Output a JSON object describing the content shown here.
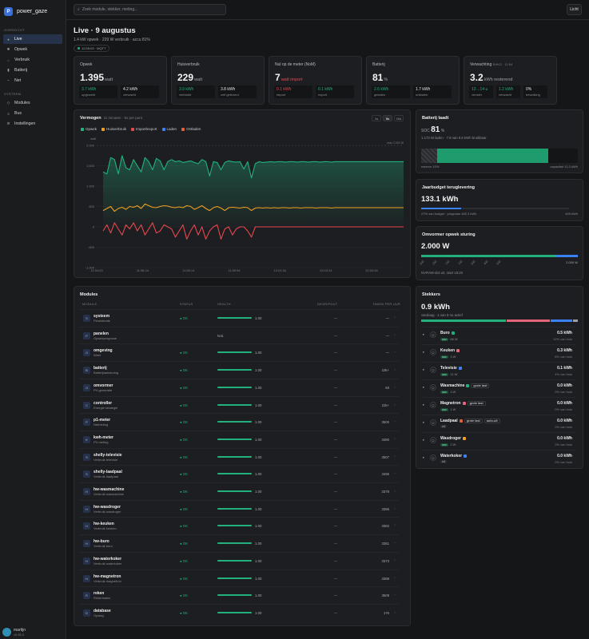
{
  "app": {
    "name": "power_gaze",
    "logo_letter": "P"
  },
  "sidebar": {
    "section_overview": "OVERZICHT",
    "section_system": "SYSTEEM",
    "items": [
      {
        "label": "Live",
        "icon": "dot-icon"
      },
      {
        "label": "Opwek",
        "icon": "sun-icon"
      },
      {
        "label": "Verbruik",
        "icon": "home-icon"
      },
      {
        "label": "Batterij",
        "icon": "battery-icon"
      },
      {
        "label": "Net",
        "icon": "grid-icon"
      },
      {
        "label": "Modules",
        "icon": "modules-icon"
      },
      {
        "label": "Bus",
        "icon": "bus-icon"
      },
      {
        "label": "Instellingen",
        "icon": "gear-icon"
      }
    ],
    "user": {
      "name": "martijn",
      "version": "v0.85.0"
    }
  },
  "topbar": {
    "search_placeholder": "Zoek module, stekker, meting...",
    "theme_label": "Licht"
  },
  "header": {
    "title": "Live · 9 augustus",
    "subtitle": "1.4 kW opwek · 229 W verbruik · accu 81%",
    "status": "12:05:03 · MQTT"
  },
  "kpis": [
    {
      "label": "Opwek",
      "value": "1.395",
      "unit": "watt",
      "boxes": [
        {
          "v": "3.7 kWh",
          "l": "opgewekt",
          "c": "g"
        },
        {
          "v": "4.2 kWh",
          "l": "verwacht",
          "c": ""
        }
      ]
    },
    {
      "label": "Huisverbruik",
      "value": "229",
      "unit": "watt",
      "boxes": [
        {
          "v": "3.9 kWh",
          "l": "verbruikt",
          "c": "g"
        },
        {
          "v": "3.8 kWh",
          "l": "zelf geleverd",
          "c": ""
        }
      ]
    },
    {
      "label": "Nul op de meter (NoM)",
      "value": "7",
      "unit": "watt import",
      "boxes": [
        {
          "v": "0.1 kWh",
          "l": "import",
          "c": "r"
        },
        {
          "v": "0.1 kWh",
          "l": "export",
          "c": "g"
        }
      ]
    },
    {
      "label": "Batterij",
      "value": "81",
      "unit": "%",
      "boxes": [
        {
          "v": "2.6 kWh",
          "l": "geladen",
          "c": "g"
        },
        {
          "v": "1.7 kWh",
          "l": "ontladen",
          "c": ""
        }
      ]
    },
    {
      "label": "Verwachting",
      "label_extra": "EHKG · 11:54",
      "value": "3.2",
      "unit": "kWh resterend",
      "boxes": [
        {
          "v": "12→14 u",
          "l": "venster",
          "c": "g"
        },
        {
          "v": "1.2 kWh",
          "l": "verwacht",
          "c": "g"
        },
        {
          "v": "0%",
          "l": "bewolking",
          "c": ""
        }
      ]
    }
  ],
  "vermogen": {
    "title": "Vermogen",
    "subtitle": "11 minuten · 5s per punt",
    "ranges": [
      "1s",
      "5s",
      "10s"
    ],
    "active_range": "5s",
    "legend": [
      {
        "name": "Opwek",
        "color": "#22b07d"
      },
      {
        "name": "Huisverbruik",
        "color": "#f0a020"
      },
      {
        "name": "Import/export",
        "color": "#e5484d"
      },
      {
        "name": "Laden",
        "color": "#3b82f6"
      },
      {
        "name": "Ontladen",
        "color": "#e0623a"
      }
    ],
    "max_label": "max 2.000 W"
  },
  "chart_data": {
    "type": "line",
    "ylabel": "watt",
    "ylim": [
      -1000,
      2000
    ],
    "yticks": [
      "2.000",
      "1.500",
      "1.000",
      "500",
      "0",
      "-500",
      "-1.000"
    ],
    "xticks": [
      "11:54:03",
      "11:56:24",
      "11:58:14",
      "11:59:54",
      "12:01:34",
      "12:03:14",
      "12:04:54"
    ],
    "series": [
      {
        "name": "Opwek",
        "color": "#22b07d",
        "values": [
          1350,
          1300,
          1700,
          1650,
          1300,
          1750,
          1450,
          1400,
          1650,
          1500,
          1350,
          1700,
          1600,
          1400,
          1680,
          1620,
          1400,
          1600,
          1650,
          1600,
          1620,
          1580,
          1600,
          1620,
          1580,
          1550,
          1650,
          1600,
          1250,
          1600,
          1580,
          1400,
          1580,
          1620,
          1600,
          1590,
          1600,
          1420,
          1600,
          1200,
          1550,
          1600,
          1580,
          1590,
          1600,
          1590,
          1600,
          1600,
          1590,
          1600,
          1600,
          1590,
          1600,
          1600,
          1590,
          1600,
          1600,
          1590,
          1600,
          1600,
          1590,
          1600,
          1600,
          1600,
          1600,
          1600,
          1600,
          1600,
          1600,
          1600,
          1600,
          1600,
          1600,
          1600,
          1600,
          1600,
          1600,
          1600,
          1600,
          1600
        ]
      },
      {
        "name": "Huisverbruik",
        "color": "#f0a020",
        "values": [
          400,
          450,
          500,
          380,
          450,
          480,
          430,
          500,
          480,
          520,
          450,
          560,
          520,
          480,
          470,
          500,
          520,
          510,
          480,
          470,
          490,
          470,
          520,
          500,
          430,
          470,
          520,
          450,
          400,
          470,
          500,
          460,
          400,
          470,
          480,
          470,
          460,
          480,
          470,
          400,
          460,
          470,
          460,
          470,
          460,
          470,
          460,
          470,
          470,
          460,
          470,
          470,
          460,
          470,
          470,
          470,
          460,
          470,
          470,
          470,
          460,
          470,
          470,
          470,
          470,
          470,
          470,
          470,
          470,
          470,
          470,
          470,
          470,
          470,
          470,
          470,
          470,
          470,
          470,
          470
        ]
      },
      {
        "name": "Import/export",
        "color": "#e5484d",
        "values": [
          -100,
          50,
          -150,
          100,
          -50,
          -200,
          50,
          -50,
          100,
          -100,
          50,
          -200,
          -50,
          100,
          -150,
          -100,
          50,
          0,
          -50,
          -250,
          -100,
          50,
          -300,
          -100,
          50,
          -200,
          0,
          -300,
          -100,
          0,
          50,
          -300,
          -50,
          0,
          -200,
          -50,
          0,
          0,
          -100,
          -250,
          0,
          0,
          0,
          0,
          0,
          0,
          0,
          0,
          0,
          0,
          0,
          0,
          0,
          0,
          0,
          0,
          0,
          0,
          0,
          0,
          0,
          0,
          0,
          0,
          0,
          0,
          0,
          0,
          0,
          0,
          0,
          0,
          0,
          0,
          0,
          0,
          0,
          0,
          0,
          0
        ]
      }
    ]
  },
  "battery": {
    "title": "Batterij laadt",
    "soc_label": "SOC",
    "soc": "81",
    "soc_unit": "%",
    "detail": "1.173 W laden · 7.8 van 9.6 kWh bruikbaar",
    "soc_fraction": 0.81,
    "reserve_fraction": 0.1,
    "reserve_label": "reserve 10%",
    "capacity_label": "capaciteit 11.0 kWh"
  },
  "budget": {
    "title": "Jaarbudget teruglevering",
    "value": "133.1 kWh",
    "fraction": 0.27,
    "left": "27% van budget · prognose 482.3 kWh",
    "right": "499 kWh"
  },
  "omvormer": {
    "title": "Omvormer opwek sturing",
    "value": "2.000 W",
    "fraction": 0.86,
    "ticks": [
      "300",
      "250",
      "150",
      "100",
      "300",
      "400",
      "500"
    ],
    "right": "2.000 W",
    "footer": "NVRAM-slot uit, start 18:20"
  },
  "modules": {
    "title": "Modules",
    "headers": [
      "MODULE",
      "STATUS",
      "HEALTH",
      "DEGR/FOUT",
      "TAKEN PER UUR"
    ],
    "rows": [
      {
        "letter": "S",
        "name": "systeem",
        "desc": "Persistentie",
        "status": "● OK",
        "health": 1.0,
        "hlabel": "1.00",
        "err": "—",
        "tasks": "—"
      },
      {
        "letter": "P",
        "name": "panelen",
        "desc": "Opwekprognose",
        "status": "",
        "health": 0,
        "hlabel": "N.B.",
        "err": "—",
        "tasks": "—"
      },
      {
        "letter": "O",
        "name": "omgeving",
        "desc": "Weer",
        "status": "● OK",
        "health": 1.0,
        "hlabel": "1.00",
        "err": "—",
        "tasks": "—"
      },
      {
        "letter": "B",
        "name": "batterij",
        "desc": "Batterijaansturing",
        "status": "● OK",
        "health": 1.0,
        "hlabel": "1.00",
        "err": "—",
        "tasks": "10k+"
      },
      {
        "letter": "O",
        "name": "omvormer",
        "desc": "PV-generatie",
        "status": "● OK",
        "health": 1.0,
        "hlabel": "1.00",
        "err": "—",
        "tasks": "60"
      },
      {
        "letter": "C",
        "name": "controller",
        "desc": "Energie strategie",
        "status": "● OK",
        "health": 1.0,
        "hlabel": "1.00",
        "err": "—",
        "tasks": "22k+"
      },
      {
        "letter": "P",
        "name": "p1-meter",
        "desc": "Netmeting",
        "status": "● OK",
        "health": 1.0,
        "hlabel": "1.00",
        "err": "—",
        "tasks": "3500"
      },
      {
        "letter": "K",
        "name": "kwh-meter",
        "desc": "PV-meting",
        "status": "● OK",
        "health": 1.0,
        "hlabel": "1.00",
        "err": "—",
        "tasks": "3480"
      },
      {
        "letter": "S",
        "name": "shelly-televisie",
        "desc": "Verbruik televisie",
        "status": "● OK",
        "health": 1.0,
        "hlabel": "1.00",
        "err": "—",
        "tasks": "3507"
      },
      {
        "letter": "S",
        "name": "shelly-laadpaal",
        "desc": "Verbruik laadpaal",
        "status": "● OK",
        "health": 1.0,
        "hlabel": "1.00",
        "err": "—",
        "tasks": "3495"
      },
      {
        "letter": "H",
        "name": "hw-wasmachine",
        "desc": "Verbruik wasmachine",
        "status": "● OK",
        "health": 1.0,
        "hlabel": "1.00",
        "err": "—",
        "tasks": "3378"
      },
      {
        "letter": "H",
        "name": "hw-wasdroger",
        "desc": "Verbruik wasdroger",
        "status": "● OK",
        "health": 1.0,
        "hlabel": "1.00",
        "err": "—",
        "tasks": "3396"
      },
      {
        "letter": "H",
        "name": "hw-keuken",
        "desc": "Verbruik keuken",
        "status": "● OK",
        "health": 1.0,
        "hlabel": "1.00",
        "err": "—",
        "tasks": "3382"
      },
      {
        "letter": "H",
        "name": "hw-buro",
        "desc": "Verbruik buro",
        "status": "● OK",
        "health": 1.0,
        "hlabel": "1.00",
        "err": "—",
        "tasks": "3381"
      },
      {
        "letter": "H",
        "name": "hw-waterkoker",
        "desc": "Verbruik waterkoker",
        "status": "● OK",
        "health": 1.0,
        "hlabel": "1.00",
        "err": "—",
        "tasks": "3373"
      },
      {
        "letter": "H",
        "name": "hw-magnetron",
        "desc": "Verbruik magnetron",
        "status": "● OK",
        "health": 1.0,
        "hlabel": "1.00",
        "err": "—",
        "tasks": "3388"
      },
      {
        "letter": "R",
        "name": "reken",
        "desc": "Rekenhalen",
        "status": "● OK",
        "health": 1.0,
        "hlabel": "1.00",
        "err": "—",
        "tasks": "3508"
      },
      {
        "letter": "D",
        "name": "database",
        "desc": "Opslag",
        "status": "● OK",
        "health": 1.0,
        "hlabel": "1.00",
        "err": "—",
        "tasks": "176"
      }
    ]
  },
  "stekkers": {
    "title": "Stekkers",
    "total": "0.9 kWh",
    "total_sub": "vandaag · 4 van 8 nu actief",
    "bar": [
      {
        "color": "#22b07d",
        "frac": 0.55
      },
      {
        "color": "#e5647a",
        "frac": 0.28
      },
      {
        "color": "#3b82f6",
        "frac": 0.14
      },
      {
        "color": "#9aa0a6",
        "frac": 0.03
      }
    ],
    "items": [
      {
        "name": "Buro",
        "color": "#22b07d",
        "state": "aan",
        "power": "66 W",
        "badges": [],
        "value": "0.5 kWh",
        "pct": "12% van huis"
      },
      {
        "name": "Keuken",
        "color": "#e5647a",
        "state": "aan",
        "power": "3 W",
        "badges": [],
        "value": "0.3 kWh",
        "pct": "8% van huis"
      },
      {
        "name": "Televisie",
        "color": "#3b82f6",
        "state": "aan",
        "power": "11 W",
        "badges": [],
        "value": "0.1 kWh",
        "pct": "4% van huis"
      },
      {
        "name": "Wasmachine",
        "color": "#22b07d",
        "state": "aan",
        "power": "3 W",
        "badges": [
          "grote last"
        ],
        "value": "0.0 kWh",
        "pct": "0% van huis"
      },
      {
        "name": "Magnetron",
        "color": "#e5647a",
        "state": "aan",
        "power": "1 W",
        "badges": [
          "grote last"
        ],
        "value": "0.0 kWh",
        "pct": "0% van huis"
      },
      {
        "name": "Laadpaal",
        "color": "#e0623a",
        "state": "uit",
        "power": "",
        "badges": [
          "grote last",
          "auto-uit"
        ],
        "value": "0.0 kWh",
        "pct": "0% van huis"
      },
      {
        "name": "Wasdroger",
        "color": "#f0a020",
        "state": "aan",
        "power": "2 W",
        "badges": [],
        "value": "0.0 kWh",
        "pct": "0% van huis"
      },
      {
        "name": "Waterkoker",
        "color": "#3b82f6",
        "state": "uit",
        "power": "",
        "badges": [],
        "value": "0.0 kWh",
        "pct": "0% van huis"
      }
    ]
  }
}
